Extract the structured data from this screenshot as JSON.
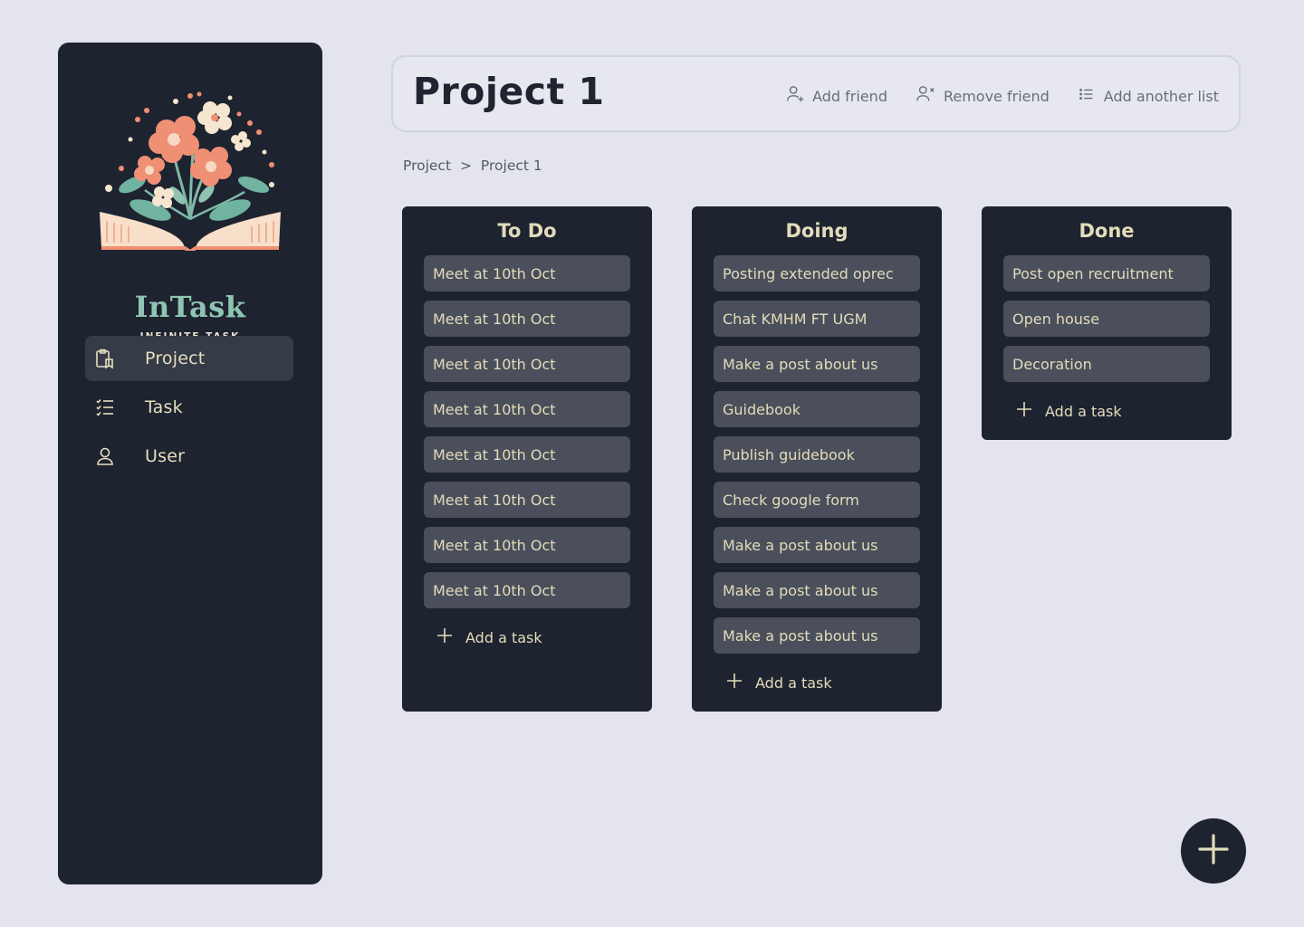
{
  "brand": {
    "name": "InTask",
    "tagline": "INFINITE TASK"
  },
  "nav": [
    {
      "label": "Project",
      "icon": "clipboard-icon",
      "active": true
    },
    {
      "label": "Task",
      "icon": "checklist-icon",
      "active": false
    },
    {
      "label": "User",
      "icon": "user-icon",
      "active": false
    }
  ],
  "header": {
    "title": "Project 1",
    "add_friend": "Add friend",
    "remove_friend": "Remove friend",
    "add_list": "Add another list"
  },
  "breadcrumb": {
    "root": "Project",
    "sep": ">",
    "current": "Project 1"
  },
  "lists": [
    {
      "title": "To Do",
      "cards": [
        "Meet at 10th Oct",
        "Meet at 10th Oct",
        "Meet at 10th Oct",
        "Meet at 10th Oct",
        "Meet at 10th Oct",
        "Meet at 10th Oct",
        "Meet at 10th Oct",
        "Meet at 10th Oct"
      ],
      "add_label": "Add a task"
    },
    {
      "title": "Doing",
      "cards": [
        "Posting extended oprec",
        "Chat KMHM FT UGM",
        "Make a post about us",
        "Guidebook",
        "Publish guidebook",
        "Check google form",
        "Make a post about us",
        "Make a post about us",
        "Make a post about us"
      ],
      "add_label": "Add a task"
    },
    {
      "title": "Done",
      "cards": [
        "Post open recruitment",
        "Open house",
        "Decoration"
      ],
      "add_label": "Add a task"
    }
  ],
  "colors": {
    "background": "#e3e4ed",
    "panel": "#1e2330",
    "card": "#4a4f5b",
    "accent_text": "#e3dcba",
    "brand_teal": "#8fc4b2",
    "flower_coral": "#ef8f74"
  }
}
